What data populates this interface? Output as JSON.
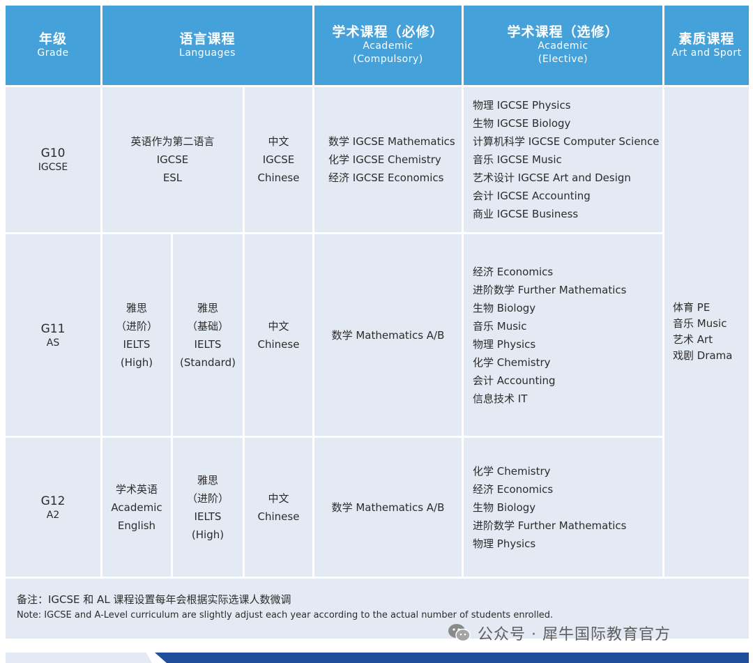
{
  "header": {
    "grade": {
      "zh": "年级",
      "en": "Grade"
    },
    "languages": {
      "zh": "语言课程",
      "en": "Languages"
    },
    "compulsory": {
      "zh": "学术课程（必修）",
      "en1": "Academic",
      "en2": "(Compulsory)"
    },
    "elective": {
      "zh": "学术课程（选修）",
      "en1": "Academic",
      "en2": "(Elective)"
    },
    "sport": {
      "zh": "素质课程",
      "en": "Art and Sport"
    }
  },
  "rows": {
    "g10": {
      "grade": "G10",
      "sub": "IGCSE",
      "lang1": [
        "英语作为第二语言",
        "IGCSE",
        "ESL"
      ],
      "chinese": [
        "中文",
        "IGCSE",
        "Chinese"
      ],
      "compulsory": [
        "数学 IGCSE Mathematics",
        "化学 IGCSE Chemistry",
        "经济 IGCSE Economics"
      ],
      "elective": [
        "物理 IGCSE Physics",
        "生物 IGCSE Biology",
        "计算机科学 IGCSE Computer Science",
        "音乐 IGCSE Music",
        "艺术设计 IGCSE Art and Design",
        "会计 IGCSE Accounting",
        "商业 IGCSE Business"
      ]
    },
    "g11": {
      "grade": "G11",
      "sub": "AS",
      "lang1": [
        "雅思",
        "（进阶）",
        "IELTS",
        "(High)"
      ],
      "lang2": [
        "雅思",
        "（基础）",
        "IELTS",
        "(Standard)"
      ],
      "chinese": [
        "中文",
        "Chinese"
      ],
      "compulsory": [
        "数学 Mathematics A/B"
      ],
      "elective": [
        "经济 Economics",
        "进阶数学 Further Mathematics",
        "生物 Biology",
        "音乐 Music",
        "物理 Physics",
        "化学 Chemistry",
        "会计 Accounting",
        "信息技术 IT"
      ]
    },
    "g12": {
      "grade": "G12",
      "sub": "A2",
      "lang1": [
        "学术英语",
        "Academic",
        "English"
      ],
      "lang2": [
        "雅思",
        "（进阶）",
        "IELTS",
        "(High)"
      ],
      "chinese": [
        "中文",
        "Chinese"
      ],
      "compulsory": [
        "数学 Mathematics A/B"
      ],
      "elective": [
        "化学 Chemistry",
        "经济 Economics",
        "生物 Biology",
        "进阶数学 Further Mathematics",
        "物理 Physics"
      ]
    }
  },
  "sport": [
    "体育 PE",
    "音乐 Music",
    "艺术 Art",
    "戏剧 Drama"
  ],
  "note": {
    "zh": "备注：IGCSE 和 AL 课程设置每年会根据实际选课人数微调",
    "en": "Note: IGCSE and A-Level curriculum are slightly adjust each year according to the actual number of students enrolled."
  },
  "watermark": "公众号 · 犀牛国际教育官方",
  "colors": {
    "header": "#45a1da",
    "body": "#e4eaf3",
    "footer_bar": "#1f4f9a"
  }
}
